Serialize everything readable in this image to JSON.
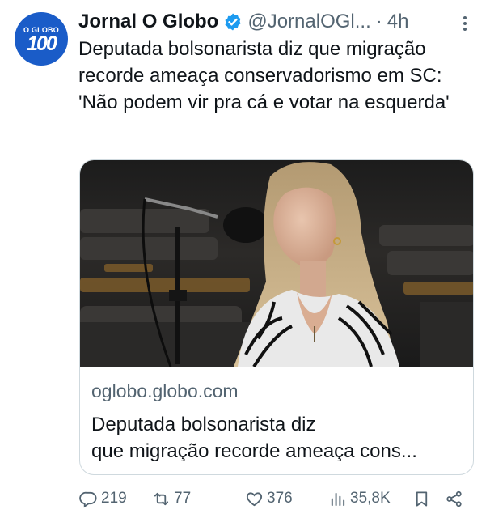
{
  "author": {
    "avatar_brand": "O GLOBO",
    "avatar_number": "100",
    "name": "Jornal O Globo",
    "handle": "@JornalOGl...",
    "separator": "·",
    "time": "4h"
  },
  "tweet": {
    "text": "Deputada bolsonarista diz que migração recorde ameaça conservadorismo em SC: 'Não podem vir pra cá e votar na esquerda'"
  },
  "card": {
    "domain": "oglobo.globo.com",
    "title_line1": "Deputada bolsonarista diz",
    "title_line2": "que migração recorde ameaça cons..."
  },
  "actions": {
    "replies": "219",
    "retweets": "77",
    "likes": "376",
    "views": "35,8K"
  },
  "colors": {
    "brand_blue": "#1a5cc8",
    "verified_blue": "#1d9bf0",
    "muted_text": "#536471",
    "text": "#0f1419"
  },
  "icons": [
    "verified-badge-icon",
    "more-options-icon",
    "reply-icon",
    "retweet-icon",
    "like-icon",
    "views-icon",
    "bookmark-icon",
    "share-icon"
  ]
}
